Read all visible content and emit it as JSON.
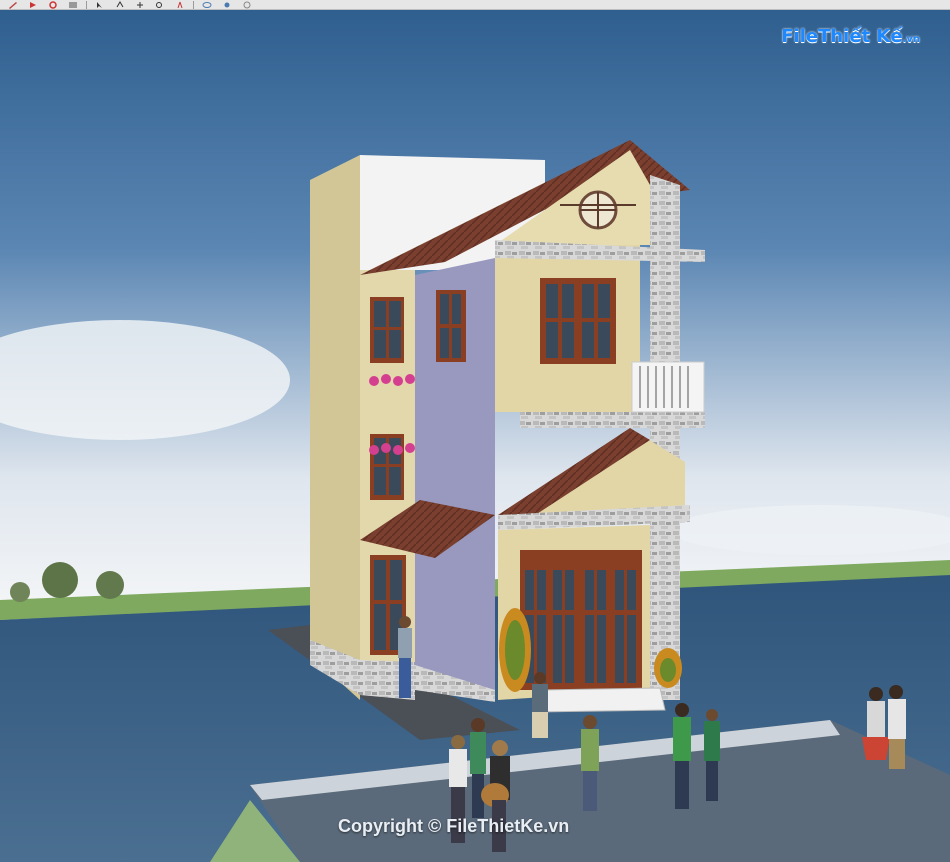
{
  "toolbar": {
    "icons": [
      "pencil-icon",
      "arrow-icon",
      "rotate-icon",
      "paint-icon",
      "select-icon",
      "orbit-icon",
      "pan-icon",
      "zoom-icon",
      "walk-icon",
      "eye-icon",
      "settings-icon",
      "globe-icon"
    ]
  },
  "watermark": {
    "brand_main": "FileThiết Kế",
    "brand_suffix": ".vn",
    "copyright": "Copyright © FileThietKe.vn"
  },
  "colors": {
    "sky_top": "#2f5f8f",
    "sky_horizon": "#f6f7f8",
    "water": "#3e6387",
    "land": "#7ea95e",
    "road": "#5b6a7a",
    "wall_cream": "#e2d5a6",
    "wall_purple": "#9999c0",
    "roof": "#7a3f2e",
    "stone": "#cfcfcf",
    "window_frame": "#8a3e22"
  }
}
